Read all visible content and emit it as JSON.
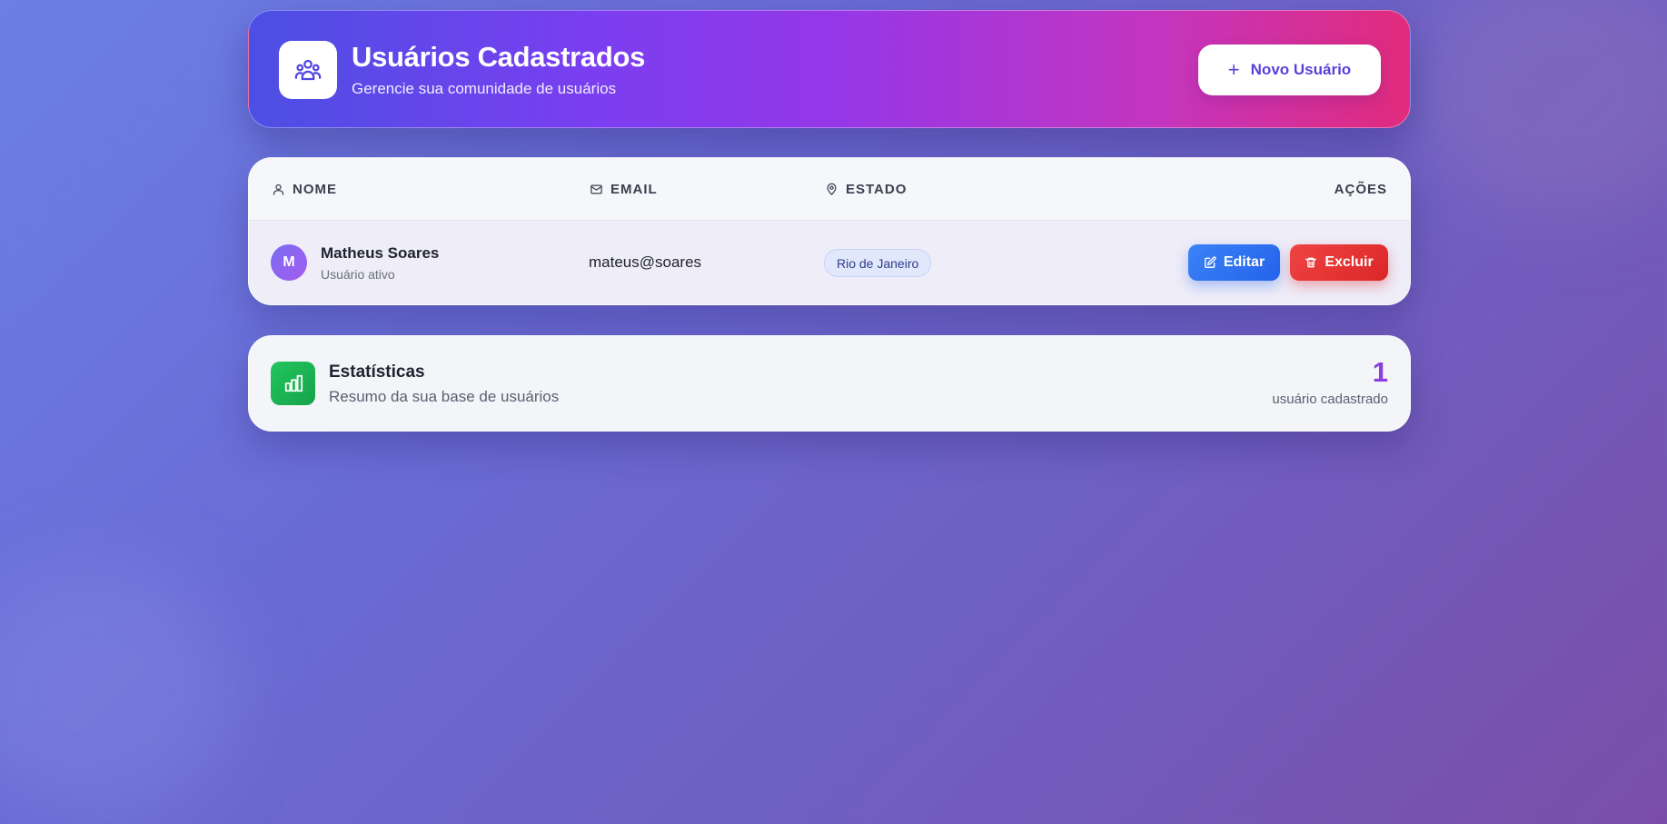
{
  "header": {
    "title": "Usuários Cadastrados",
    "subtitle": "Gerencie sua comunidade de usuários",
    "icon": "users-group-icon",
    "new_user_button": "Novo Usuário"
  },
  "table": {
    "columns": {
      "nome": "NOME",
      "email": "EMAIL",
      "estado": "ESTADO",
      "acoes": "AÇÕES"
    },
    "rows": [
      {
        "avatar_initial": "M",
        "name": "Matheus Soares",
        "status": "Usuário ativo",
        "email": "mateus@soares",
        "state": "Rio de Janeiro",
        "edit_label": "Editar",
        "delete_label": "Excluir"
      }
    ]
  },
  "stats": {
    "title": "Estatísticas",
    "subtitle": "Resumo da sua base de usuários",
    "count": "1",
    "count_label": "usuário cadastrado",
    "icon": "bar-chart-icon"
  },
  "colors": {
    "accent": "#8b3fe0",
    "edit": "#2563eb",
    "delete": "#dc2626",
    "stats_icon": "#16a34a"
  }
}
